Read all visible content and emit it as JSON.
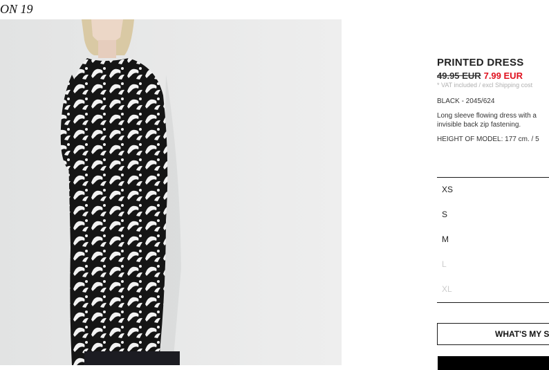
{
  "header": {
    "season_text": "ON 19"
  },
  "product": {
    "title": "PRINTED DRESS",
    "old_price": "49.95 EUR",
    "new_price": "7.99 EUR",
    "vat_note": "* VAT included / excl Shipping cost",
    "color_ref": "BLACK - 2045/624",
    "description": "Long sleeve flowing dress with a invisible back zip fastening.",
    "model_height": "HEIGHT OF MODEL: 177 cm. / 5",
    "price_color": "#e0111f"
  },
  "sizes": [
    {
      "label": "XS",
      "available": true
    },
    {
      "label": "S",
      "available": true
    },
    {
      "label": "M",
      "available": true
    },
    {
      "label": "L",
      "available": false
    },
    {
      "label": "XL",
      "available": false
    }
  ],
  "actions": {
    "size_guide_label": "WHAT'S MY S",
    "add_to_bag_label": ""
  },
  "image": {
    "subject": "model-wearing-printed-dress"
  }
}
